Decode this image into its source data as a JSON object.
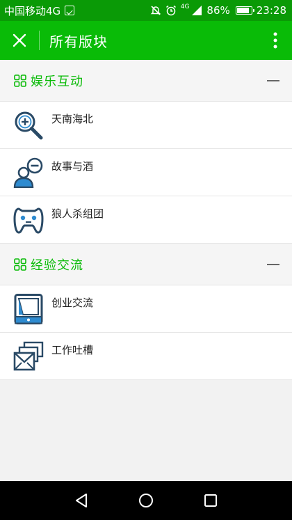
{
  "status_bar": {
    "carrier": "中国移动4G",
    "network_type": "4G",
    "battery_percent": "86%",
    "battery_level": 0.86,
    "time": "23:28"
  },
  "header": {
    "title": "所有版块",
    "close_icon": "close-icon",
    "more_icon": "more-vertical-icon"
  },
  "sections": [
    {
      "title": "娱乐互动",
      "items": [
        {
          "label": "天南海北",
          "icon": "magnifier-plus-icon"
        },
        {
          "label": "故事与酒",
          "icon": "user-minus-icon"
        },
        {
          "label": "狼人杀组团",
          "icon": "gamepad-icon"
        }
      ]
    },
    {
      "title": "经验交流",
      "items": [
        {
          "label": "创业交流",
          "icon": "tablet-icon"
        },
        {
          "label": "工作吐槽",
          "icon": "stacked-mail-icon"
        }
      ]
    }
  ],
  "colors": {
    "status_bar": "#0a9a06",
    "title_bar": "#09bb07",
    "accent": "#09bb07",
    "icon_dark": "#2a4a66",
    "icon_light": "#2e8bd0"
  }
}
